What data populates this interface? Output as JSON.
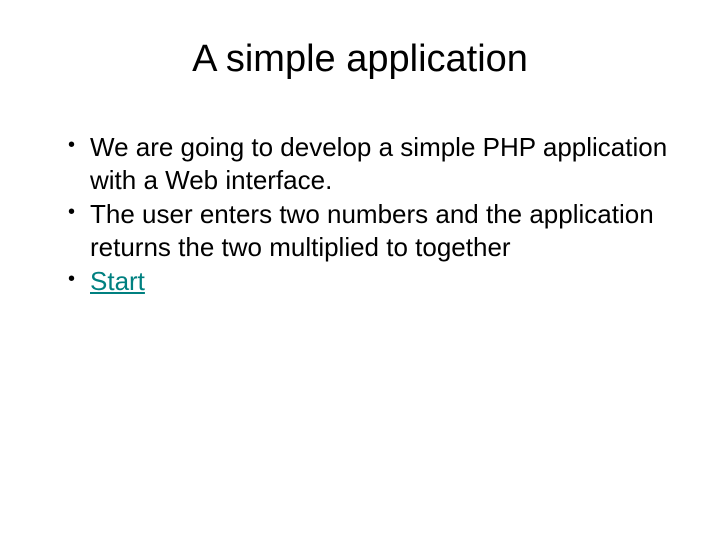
{
  "title": "A simple application",
  "bullets": [
    "We are going to develop a simple PHP application with a Web interface.",
    "The user enters two numbers and the application returns the two multiplied to together"
  ],
  "link": {
    "label": "Start"
  },
  "colors": {
    "link": "#008080"
  }
}
